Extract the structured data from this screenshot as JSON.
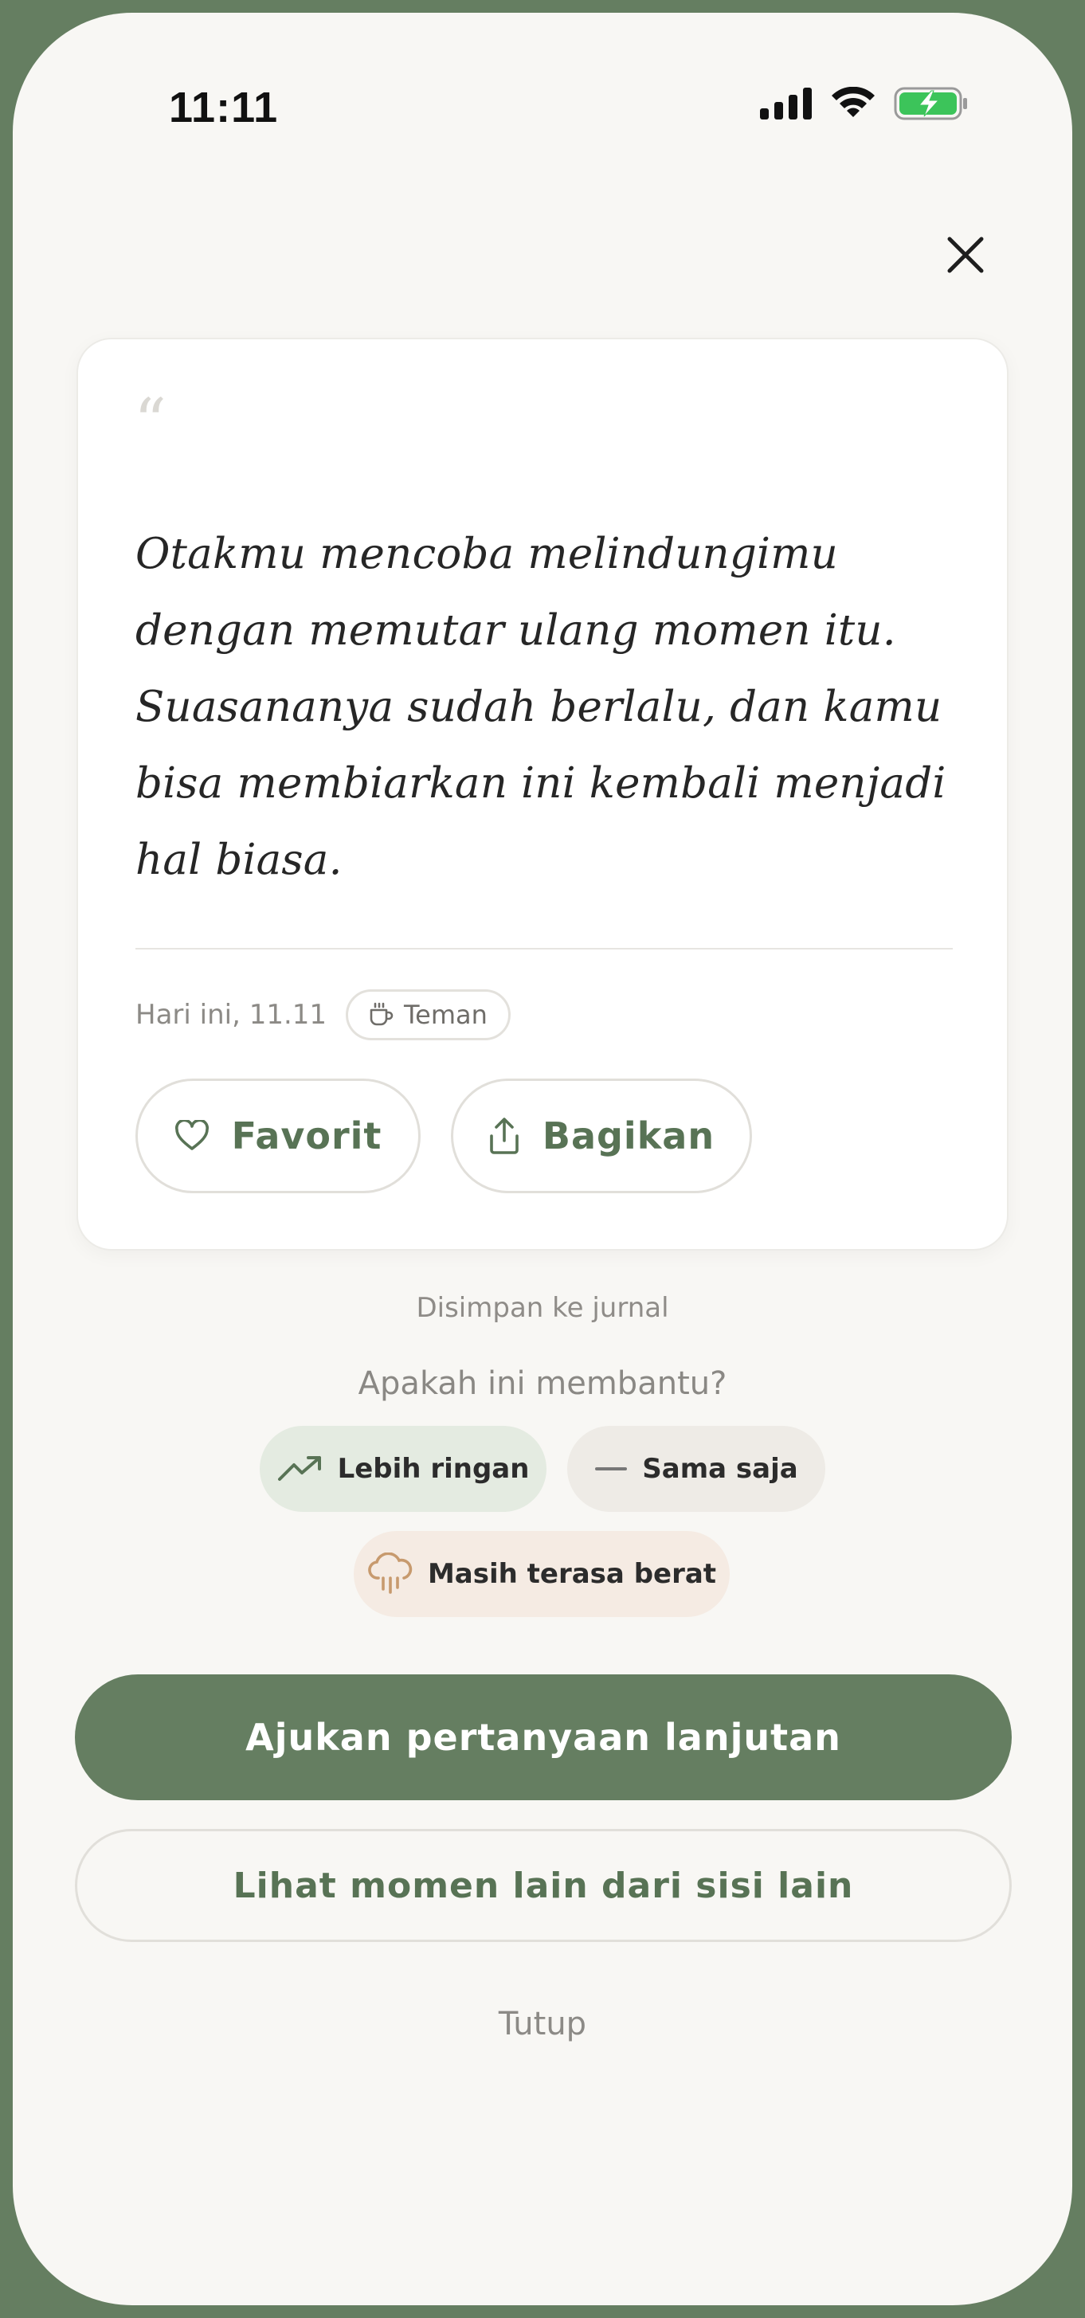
{
  "status_bar": {
    "time": "11:11"
  },
  "quote": {
    "mark": "“",
    "text": "Otakmu mencoba melindungimu dengan memutar ulang momen itu. Suasananya sudah berlalu, dan kamu bisa membiarkan ini kembali menjadi hal biasa.",
    "timestamp": "Hari ini, 11.11",
    "tag": {
      "label": "Teman",
      "icon": "coffee-cup-icon"
    }
  },
  "card_actions": {
    "favorite": {
      "label": "Favorit",
      "icon": "heart-icon"
    },
    "share": {
      "label": "Bagikan",
      "icon": "share-icon"
    }
  },
  "saved_note": "Disimpan ke jurnal",
  "feedback": {
    "question": "Apakah ini membantu?",
    "options": [
      {
        "label": "Lebih ringan",
        "icon": "trending-up-icon"
      },
      {
        "label": "Sama saja",
        "icon": "minus-icon"
      },
      {
        "label": "Masih terasa berat",
        "icon": "rain-cloud-icon"
      }
    ]
  },
  "actions": {
    "primary": "Ajukan pertanyaan lanjutan",
    "secondary": "Lihat momen lain dari sisi lain",
    "close": "Tutup"
  },
  "colors": {
    "brand_green": "#657e61",
    "green_text": "#587355",
    "lighter_chip": "#e4ebe1",
    "same_chip": "#eeebe6",
    "heavy_chip": "#f5ebe3",
    "heavy_icon": "#c79a6e",
    "battery_green": "#3cc45a"
  }
}
